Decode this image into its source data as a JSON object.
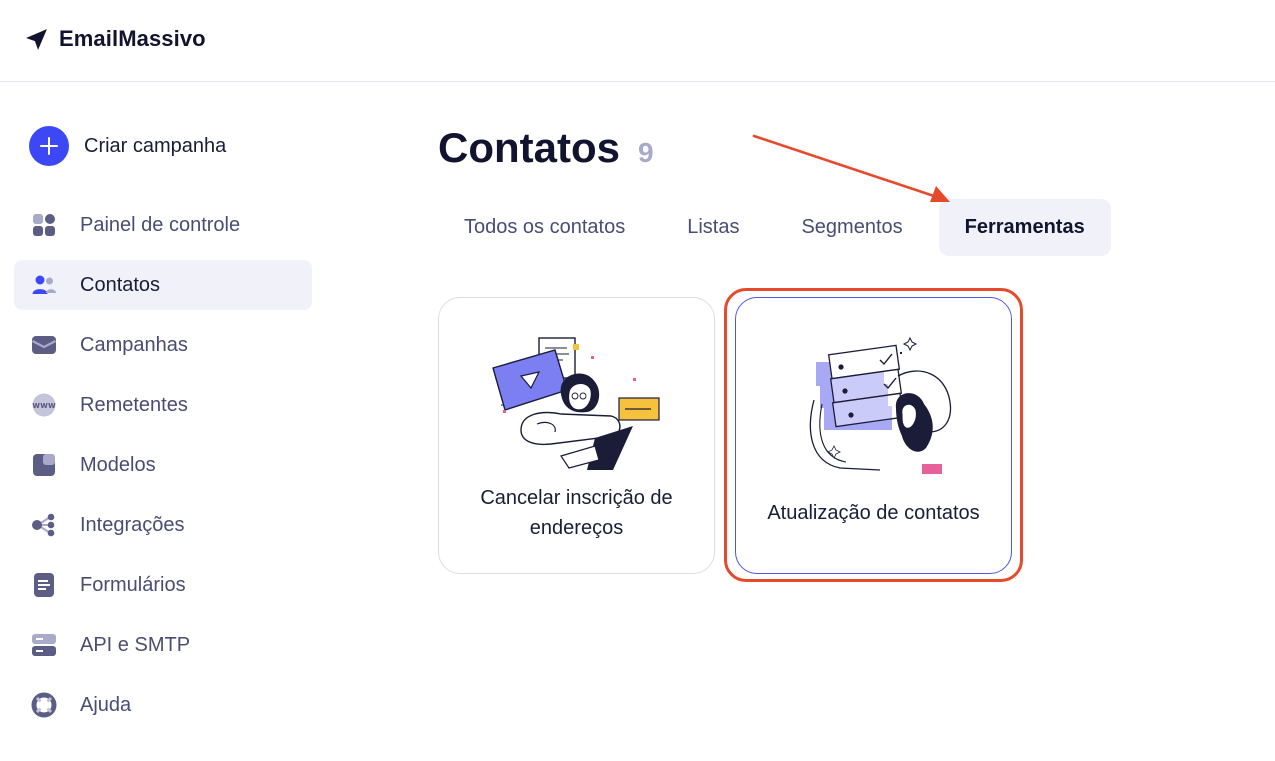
{
  "app": {
    "brand_name": "EmailMassivo",
    "brand_icon": "paper-plane-icon"
  },
  "sidebar": {
    "create_label": "Criar campanha",
    "items": [
      {
        "label": "Painel de controle",
        "icon": "dashboard-icon",
        "active": false
      },
      {
        "label": "Contatos",
        "icon": "contacts-icon",
        "active": true
      },
      {
        "label": "Campanhas",
        "icon": "campaign-icon",
        "active": false
      },
      {
        "label": "Remetentes",
        "icon": "www-icon",
        "active": false
      },
      {
        "label": "Modelos",
        "icon": "template-icon",
        "active": false
      },
      {
        "label": "Integrações",
        "icon": "integrations-icon",
        "active": false
      },
      {
        "label": "Formulários",
        "icon": "form-icon",
        "active": false
      },
      {
        "label": "API e SMTP",
        "icon": "server-icon",
        "active": false
      },
      {
        "label": "Ajuda",
        "icon": "lifebuoy-icon",
        "active": false
      }
    ]
  },
  "main": {
    "title": "Contatos",
    "count": "9",
    "tabs": [
      {
        "label": "Todos os contatos",
        "active": false
      },
      {
        "label": "Listas",
        "active": false
      },
      {
        "label": "Segmentos",
        "active": false
      },
      {
        "label": "Ferramentas",
        "active": true
      }
    ],
    "cards": [
      {
        "label": "Cancelar inscrição de endereços",
        "illustration": "unsubscribe-illustration"
      },
      {
        "label": "Atualização de contatos",
        "illustration": "contact-update-illustration"
      }
    ]
  },
  "colors": {
    "accent": "#3c48f5",
    "annotation": "#e64a2c",
    "active_bg": "#f0f1f9",
    "nav_icon": "#5b5d85"
  }
}
